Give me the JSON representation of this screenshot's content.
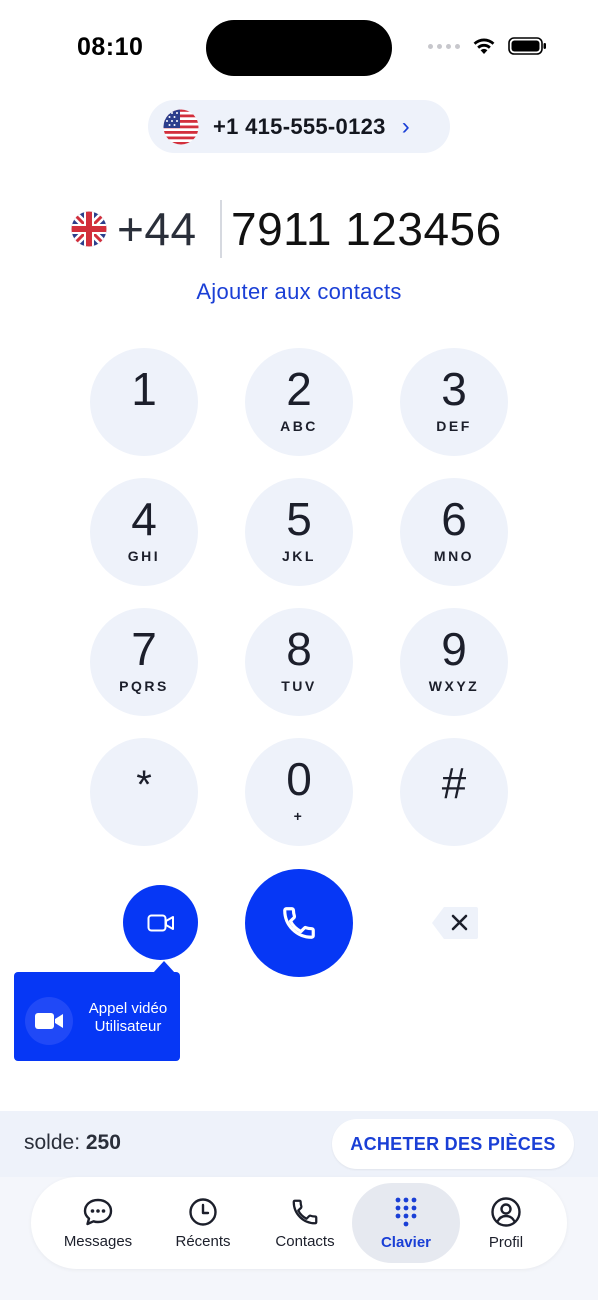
{
  "status": {
    "time": "08:10",
    "icons": [
      "signal-dots-icon",
      "wifi-icon",
      "battery-icon"
    ]
  },
  "caller_id": {
    "flag": "us-flag-icon",
    "number": "+1 415-555-0123",
    "chevron": "›"
  },
  "dialer": {
    "flag": "uk-flag-icon",
    "country_code": "+44",
    "number": "7911 123456",
    "add_contact": "Ajouter aux contacts"
  },
  "keypad": [
    {
      "digit": "1",
      "letters": ""
    },
    {
      "digit": "2",
      "letters": "ABC"
    },
    {
      "digit": "3",
      "letters": "DEF"
    },
    {
      "digit": "4",
      "letters": "GHI"
    },
    {
      "digit": "5",
      "letters": "JKL"
    },
    {
      "digit": "6",
      "letters": "MNO"
    },
    {
      "digit": "7",
      "letters": "PQRS"
    },
    {
      "digit": "8",
      "letters": "TUV"
    },
    {
      "digit": "9",
      "letters": "WXYZ"
    },
    {
      "digit": "*",
      "letters": ""
    },
    {
      "digit": "0",
      "letters": "+"
    },
    {
      "digit": "#",
      "letters": ""
    }
  ],
  "actions": {
    "video_icon": "video-camera-icon",
    "call_icon": "phone-icon",
    "backspace_icon": "backspace-icon"
  },
  "tooltip": {
    "line1": "Appel vidéo",
    "line2": "Utilisateur"
  },
  "balance": {
    "label": "solde: ",
    "value": "250",
    "buy_button": "ACHETER DES PIÈCES"
  },
  "tabs": [
    {
      "label": "Messages",
      "icon": "chat-bubble-icon",
      "active": false
    },
    {
      "label": "Récents",
      "icon": "clock-icon",
      "active": false
    },
    {
      "label": "Contacts",
      "icon": "phone-icon",
      "active": false
    },
    {
      "label": "Clavier",
      "icon": "keypad-icon",
      "active": true
    },
    {
      "label": "Profil",
      "icon": "profile-icon",
      "active": false
    }
  ],
  "colors": {
    "accent": "#0637f5",
    "link": "#1a3fd6",
    "key_bg": "#eef2fa"
  }
}
